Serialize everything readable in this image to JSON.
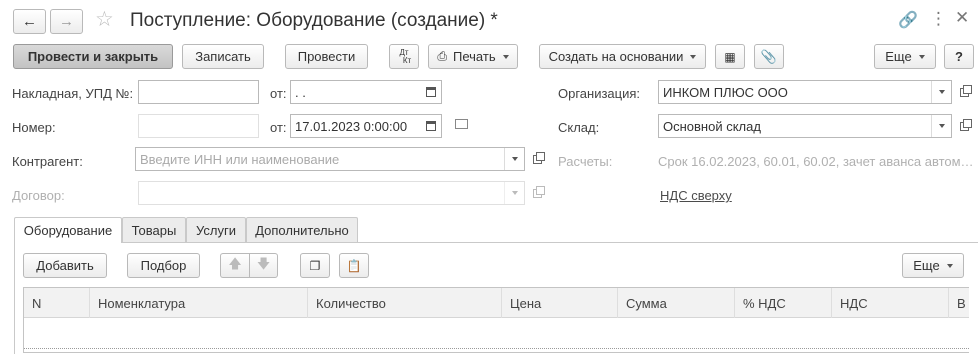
{
  "window": {
    "title": "Поступление: Оборудование (создание) *"
  },
  "toolbar": {
    "post_and_close": "Провести и закрыть",
    "write": "Записать",
    "post": "Провести",
    "dt_kt_top": "Дт",
    "dt_kt_bottom": "Кт",
    "print": "Печать",
    "create_based_on": "Создать на основании",
    "more": "Еще",
    "help": "?"
  },
  "form": {
    "invoice_label": "Накладная, УПД №:",
    "invoice_number": "",
    "invoice_from_label": "от:",
    "invoice_date": " .  .",
    "number_label": "Номер:",
    "number_value": "",
    "date_from_label": "от:",
    "date_value": "17.01.2023  0:00:00",
    "counterparty_label": "Контрагент:",
    "counterparty_placeholder": "Введите ИНН или наименование",
    "contract_label": "Договор:",
    "contract_value": "",
    "organization_label": "Организация:",
    "organization_value": "ИНКОМ ПЛЮС ООО",
    "warehouse_label": "Склад:",
    "warehouse_value": "Основной склад",
    "settlements_label": "Расчеты:",
    "settlements_value": "Срок 16.02.2023, 60.01, 60.02, зачет аванса автом…",
    "vat_link": "НДС сверху"
  },
  "tabs": [
    {
      "label": "Оборудование"
    },
    {
      "label": "Товары"
    },
    {
      "label": "Услуги"
    },
    {
      "label": "Дополнительно"
    }
  ],
  "table_toolbar": {
    "add": "Добавить",
    "select": "Подбор",
    "more": "Еще"
  },
  "table": {
    "columns": [
      "N",
      "Номенклатура",
      "Количество",
      "Цена",
      "Сумма",
      "% НДС",
      "НДС",
      "В"
    ],
    "rows": []
  },
  "colors": {
    "primary_button": "#c8c8c8",
    "border": "#b9b9b9",
    "placeholder": "#aaaaaa"
  }
}
